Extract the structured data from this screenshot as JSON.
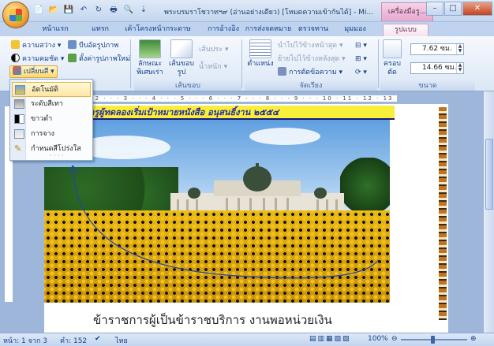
{
  "titlebar": {
    "window_title": "พระบรมราโชวาทฯ๙ (อ่านอย่างเดียว) [โหมดความเข้ากันได้] - Mi...",
    "context_tab": "เครื่องมือรู...",
    "min": "–",
    "max": "□",
    "close": "✕"
  },
  "qat": {
    "new": "📄",
    "open": "📂",
    "save": "💾",
    "undo": "↶",
    "redo": "↻",
    "print": "🖶",
    "preview": "🔍",
    "more": "⇣"
  },
  "tabs": [
    "หน้าแรก",
    "แทรก",
    "เค้าโครงหน้ากระดาษ",
    "การอ้างอิง",
    "การส่งจดหมาย",
    "ตรวจทาน",
    "มุมมอง",
    "รูปแบบ"
  ],
  "ribbon": {
    "adjust": {
      "brightness": "ความสว่าง",
      "contrast": "ความคมชัด",
      "recolor": "เปลี่ยนสี",
      "compress": "บีบอัดรูปภาพ",
      "reset": "ตั้งค่ารูปภาพใหม่"
    },
    "styles": {
      "shape": "ลักษณะ",
      "shape2": "พิเศษเร่า",
      "border_shape": "เส้นขอบ",
      "border_shape2": "รูป",
      "line_style": "เส้นประ",
      "weight": "น้ำหนัก",
      "group": "เส้นขอบ"
    },
    "arrange": {
      "position": "ตำแหน่ง",
      "front": "นำไปไว้ข้างหน้าสุด",
      "back": "ย้ายไปไว้ข้างหลังสุด",
      "wrap": "การตัดข้อความ",
      "group": "จัดเรียง"
    },
    "size": {
      "crop": "ครอบ",
      "crop2": "ตัด",
      "height": "7.62 ซม.",
      "width": "14.66 ซม.",
      "group": "ขนาด"
    }
  },
  "recolor_menu": {
    "items": [
      "อัตโนมัติ",
      "ระดับสีเทา",
      "ขาวดำ",
      "การจาง",
      "กำหนดสีโปร่งใส"
    ],
    "grip": "· · · ·"
  },
  "ruler": {
    "text": "· 1 · 1 · · · 2 · · · 3 · · · 4 · · · 5 · · · 6 · · · 7 · · · 8 · · · 9 · · · 10 · 11 · 12 · 13 · 14 · · 15 ·"
  },
  "document": {
    "banner_text": "ครูผู้ทดลองเริ่มเป้าหมายหนังสือ อนุสนธิ์งาน ๒๕๕๔",
    "caption": "ข้าราชการผู้เป็นข้าราชบริการ งานพอหน่วยเงิน"
  },
  "status": {
    "page": "หน้า: 1 จาก 3",
    "words": "คำ: 152",
    "spell": "✔",
    "lang": "ไทย",
    "zoom": "100%",
    "zoom_out": "⊖",
    "zoom_in": "⊕"
  }
}
